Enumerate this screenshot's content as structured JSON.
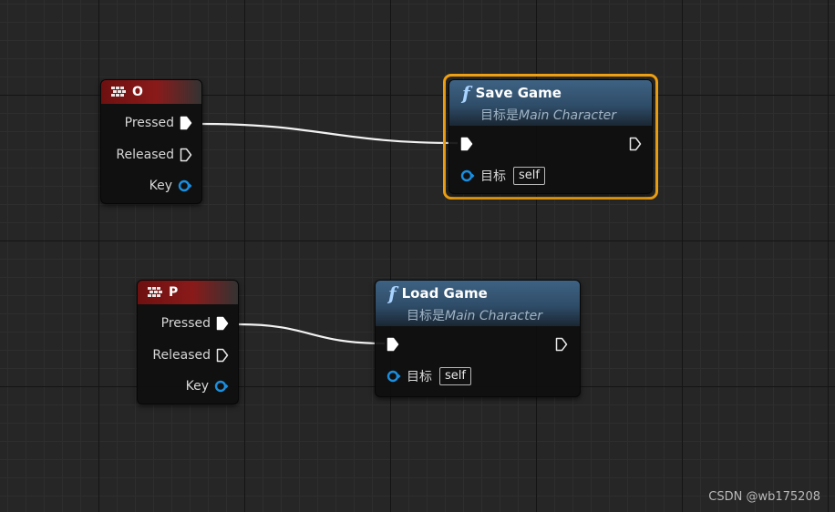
{
  "nodes": {
    "key_o": {
      "title": "O",
      "pins": {
        "pressed": "Pressed",
        "released": "Released",
        "key": "Key"
      }
    },
    "key_p": {
      "title": "P",
      "pins": {
        "pressed": "Pressed",
        "released": "Released",
        "key": "Key"
      }
    },
    "save_game": {
      "title": "Save Game",
      "subtitle_prefix": "目标是",
      "subtitle_target": "Main Character",
      "target_label": "目标",
      "target_value": "self",
      "selected": true
    },
    "load_game": {
      "title": "Load Game",
      "subtitle_prefix": "目标是",
      "subtitle_target": "Main Character",
      "target_label": "目标",
      "target_value": "self",
      "selected": false
    }
  },
  "icons": {
    "function": "f",
    "key_event": "keyboard-icon",
    "exec_pin": "exec-pin-icon",
    "object_pin": "object-pin-icon"
  },
  "colors": {
    "key_header": "#8a1a1a",
    "function_header": "#3e6283",
    "selection_outline": "#f0a010",
    "object_pin": "#1a8fe0",
    "wire": "#ffffff"
  },
  "watermark": "CSDN @wb175208"
}
